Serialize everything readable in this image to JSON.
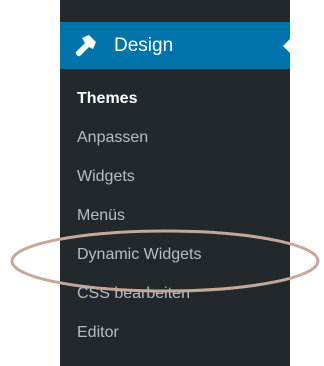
{
  "menu": {
    "header": {
      "label": "Design",
      "icon": "paintbrush-icon",
      "active_color": "#0073aa"
    },
    "items": [
      {
        "label": "Themes",
        "current": true
      },
      {
        "label": "Anpassen",
        "current": false
      },
      {
        "label": "Widgets",
        "current": false
      },
      {
        "label": "Menüs",
        "current": false
      },
      {
        "label": "Dynamic Widgets",
        "current": false,
        "highlighted": true
      },
      {
        "label": "CSS bearbeiten",
        "current": false
      },
      {
        "label": "Editor",
        "current": false
      }
    ]
  },
  "colors": {
    "sidebar_bg": "#23282d",
    "highlight_ring": "#c4a99a"
  }
}
